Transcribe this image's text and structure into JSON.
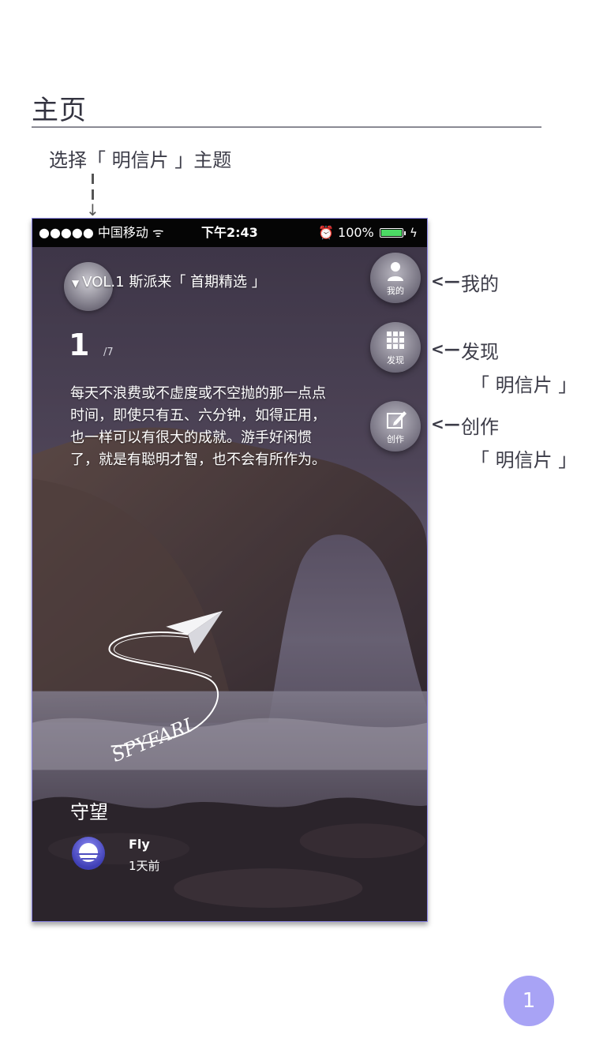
{
  "header": {
    "title": "主页",
    "theme_note": "选择「 明信片 」主题"
  },
  "phone": {
    "status_bar": {
      "left": "●●●●● 中国移动",
      "time": "下午2:43",
      "battery": "100%"
    },
    "volume_title": "VOL.1  斯派来「 首期精选 」",
    "page_number": "1",
    "page_total": "/7",
    "quote": "每天不浪费或不虚度或不空抛的那一点点时间，即使只有五、六分钟，如得正用，也一样可以有很大的成就。游手好闲惯了，就是有聪明才智，也不会有所作为。",
    "watermark": "SPYFARI",
    "post_title": "守望",
    "author": {
      "name": "Fly",
      "time": "1天前"
    },
    "side_buttons": [
      {
        "label": "我的",
        "icon": "person-icon"
      },
      {
        "label": "发现",
        "icon": "grid-icon"
      },
      {
        "label": "创作",
        "icon": "edit-icon"
      }
    ]
  },
  "callouts": [
    {
      "arrow": "<—",
      "text": "我的",
      "sub": ""
    },
    {
      "arrow": "<—",
      "text": "发现",
      "sub": "「 明信片 」"
    },
    {
      "arrow": "<—",
      "text": "创作",
      "sub": "「 明信片 」"
    }
  ],
  "page_badge": "1",
  "colors": {
    "accent": "#a8a3f5",
    "phone_border": "#8b86e6",
    "battery": "#4cd964"
  }
}
